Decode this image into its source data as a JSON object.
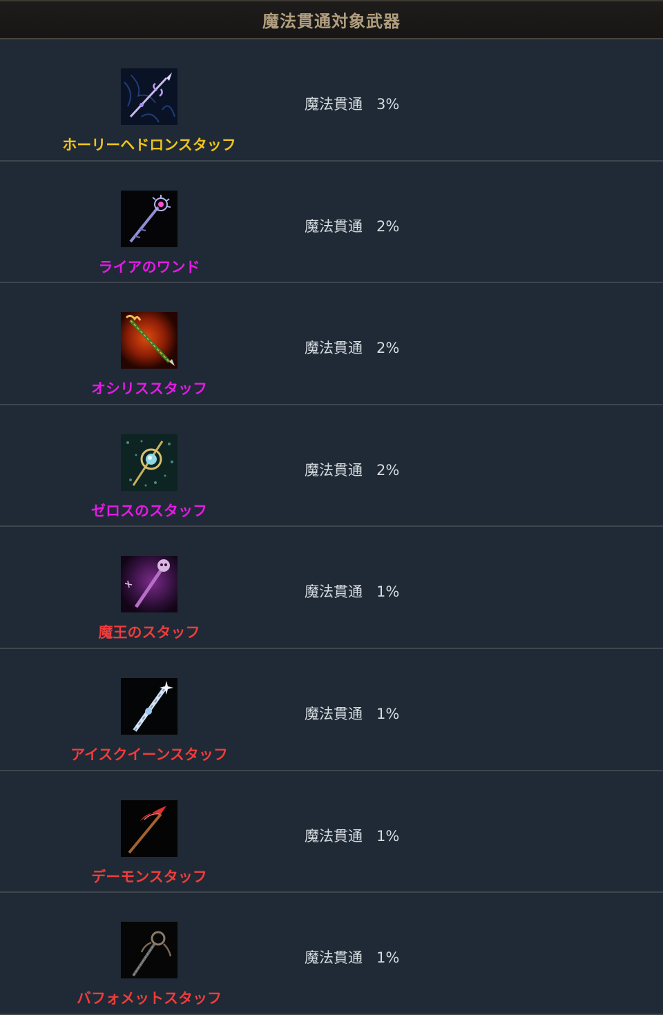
{
  "header": {
    "title": "魔法貫通対象武器"
  },
  "items": [
    {
      "name": "ホーリーヘドロンスタッフ",
      "stat_label": "魔法貫通",
      "stat_value": "3%",
      "color": "#f0c419",
      "icon": "holy-hedron-staff-icon"
    },
    {
      "name": "ライアのワンド",
      "stat_label": "魔法貫通",
      "stat_value": "2%",
      "color": "#e619e6",
      "icon": "lyre-wand-icon"
    },
    {
      "name": "オシリススタッフ",
      "stat_label": "魔法貫通",
      "stat_value": "2%",
      "color": "#e619e6",
      "icon": "osiris-staff-icon"
    },
    {
      "name": "ゼロスのスタッフ",
      "stat_label": "魔法貫通",
      "stat_value": "2%",
      "color": "#e619e6",
      "icon": "zeros-staff-icon"
    },
    {
      "name": "魔王のスタッフ",
      "stat_label": "魔法貫通",
      "stat_value": "1%",
      "color": "#f03c3c",
      "icon": "demon-king-staff-icon"
    },
    {
      "name": "アイスクイーンスタッフ",
      "stat_label": "魔法貫通",
      "stat_value": "1%",
      "color": "#f03c3c",
      "icon": "ice-queen-staff-icon"
    },
    {
      "name": "デーモンスタッフ",
      "stat_label": "魔法貫通",
      "stat_value": "1%",
      "color": "#f03c3c",
      "icon": "demon-staff-icon"
    },
    {
      "name": "バフォメットスタッフ",
      "stat_label": "魔法貫通",
      "stat_value": "1%",
      "color": "#f03c3c",
      "icon": "baphomet-staff-icon"
    }
  ]
}
